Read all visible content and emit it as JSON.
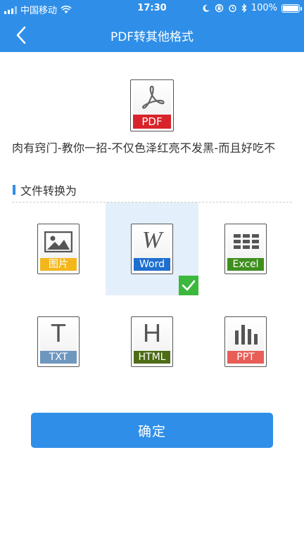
{
  "status_bar": {
    "carrier": "中国移动",
    "time": "17:30",
    "battery": "100%"
  },
  "nav": {
    "title": "PDF转其他格式"
  },
  "source": {
    "label": "PDF",
    "file_name": "肉有窍门-教你一招-不仅色泽红亮不发黑-而且好吃不"
  },
  "section": {
    "title": "文件转换为"
  },
  "formats": [
    {
      "label": "图片",
      "color": "#f3b71c"
    },
    {
      "label": "Word",
      "color": "#1f6fcf",
      "selected": true
    },
    {
      "label": "Excel",
      "color": "#3f8f1e"
    },
    {
      "label": "TXT",
      "color": "#6e97c0"
    },
    {
      "label": "HTML",
      "color": "#4c6c15"
    },
    {
      "label": "PPT",
      "color": "#e85d57"
    }
  ],
  "confirm_label": "确定",
  "colors": {
    "primary": "#2f8fe8",
    "pdf_red": "#d9232a",
    "selected_bg": "#e3effa",
    "check_green": "#3cb83c"
  }
}
